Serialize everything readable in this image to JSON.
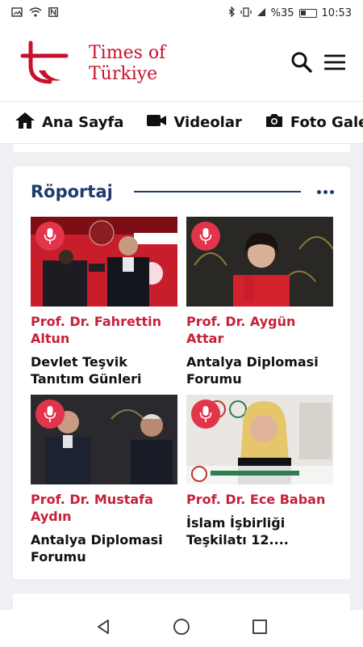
{
  "status_bar": {
    "battery_percent": "%35",
    "time": "10:53"
  },
  "header": {
    "brand_line1": "Times of",
    "brand_line2": "Türkiye"
  },
  "nav": {
    "items": [
      {
        "label": "Ana Sayfa",
        "icon": "home-icon"
      },
      {
        "label": "Videolar",
        "icon": "video-camera-icon"
      },
      {
        "label": "Foto Galeri",
        "icon": "photo-camera-icon"
      }
    ]
  },
  "section": {
    "title": "Röportaj"
  },
  "interviews": [
    {
      "name": "Prof. Dr. Fahrettin Altun",
      "title": "Devlet Teşvik Tanıtım Günleri"
    },
    {
      "name": "Prof. Dr. Aygün Attar",
      "title": "Antalya Diplomasi Forumu"
    },
    {
      "name": "Prof. Dr. Mustafa Aydın",
      "title": "Antalya Diplomasi Forumu"
    },
    {
      "name": "Prof. Dr. Ece Baban",
      "title": "İslam İşbirliği Teşkilatı 12...."
    }
  ],
  "colors": {
    "brand_red": "#c8102e",
    "section_blue": "#1e3a6e",
    "name_red": "#c8203a",
    "mic_red": "#e2344a"
  }
}
